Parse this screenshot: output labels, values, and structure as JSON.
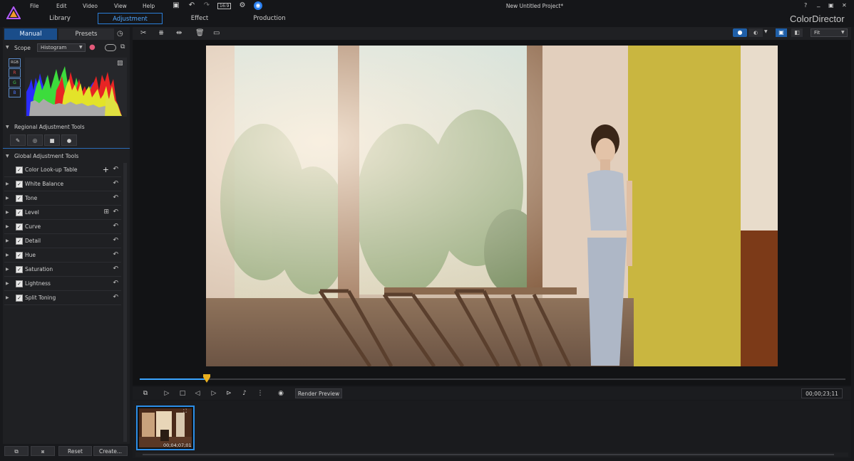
{
  "menu": [
    "File",
    "Edit",
    "Video",
    "View",
    "Help"
  ],
  "window": {
    "title": "New Untitled Project*",
    "brand": "ColorDirector",
    "controls": [
      "?",
      "_",
      "▣",
      "✕"
    ],
    "quick_badge": "16:9"
  },
  "modes": [
    "Library",
    "Adjustment",
    "Effect",
    "Production"
  ],
  "panel_tabs": [
    "Manual",
    "Presets"
  ],
  "scope": {
    "label": "Scope",
    "type": "Histogram",
    "channels": [
      "RGB",
      "R",
      "G",
      "B"
    ]
  },
  "regional": {
    "title": "Regional Adjustment Tools"
  },
  "global": {
    "title": "Global Adjustment Tools",
    "tools": [
      "Color Look-up Table",
      "White Balance",
      "Tone",
      "Level",
      "Curve",
      "Detail",
      "Hue",
      "Saturation",
      "Lightness",
      "Split Toning"
    ]
  },
  "bottom_buttons": {
    "reset": "Reset",
    "create": "Create..."
  },
  "view": {
    "fit": "Fit"
  },
  "playback": {
    "render_preview": "Render Preview",
    "timecode": "00;00;23;11",
    "progress": 0.095
  },
  "clip": {
    "duration": "00;04;07;01"
  },
  "colors": {
    "accent": "#2b7ed8",
    "playhead": "#e8b020",
    "wall_yellow": "#c9b640"
  }
}
